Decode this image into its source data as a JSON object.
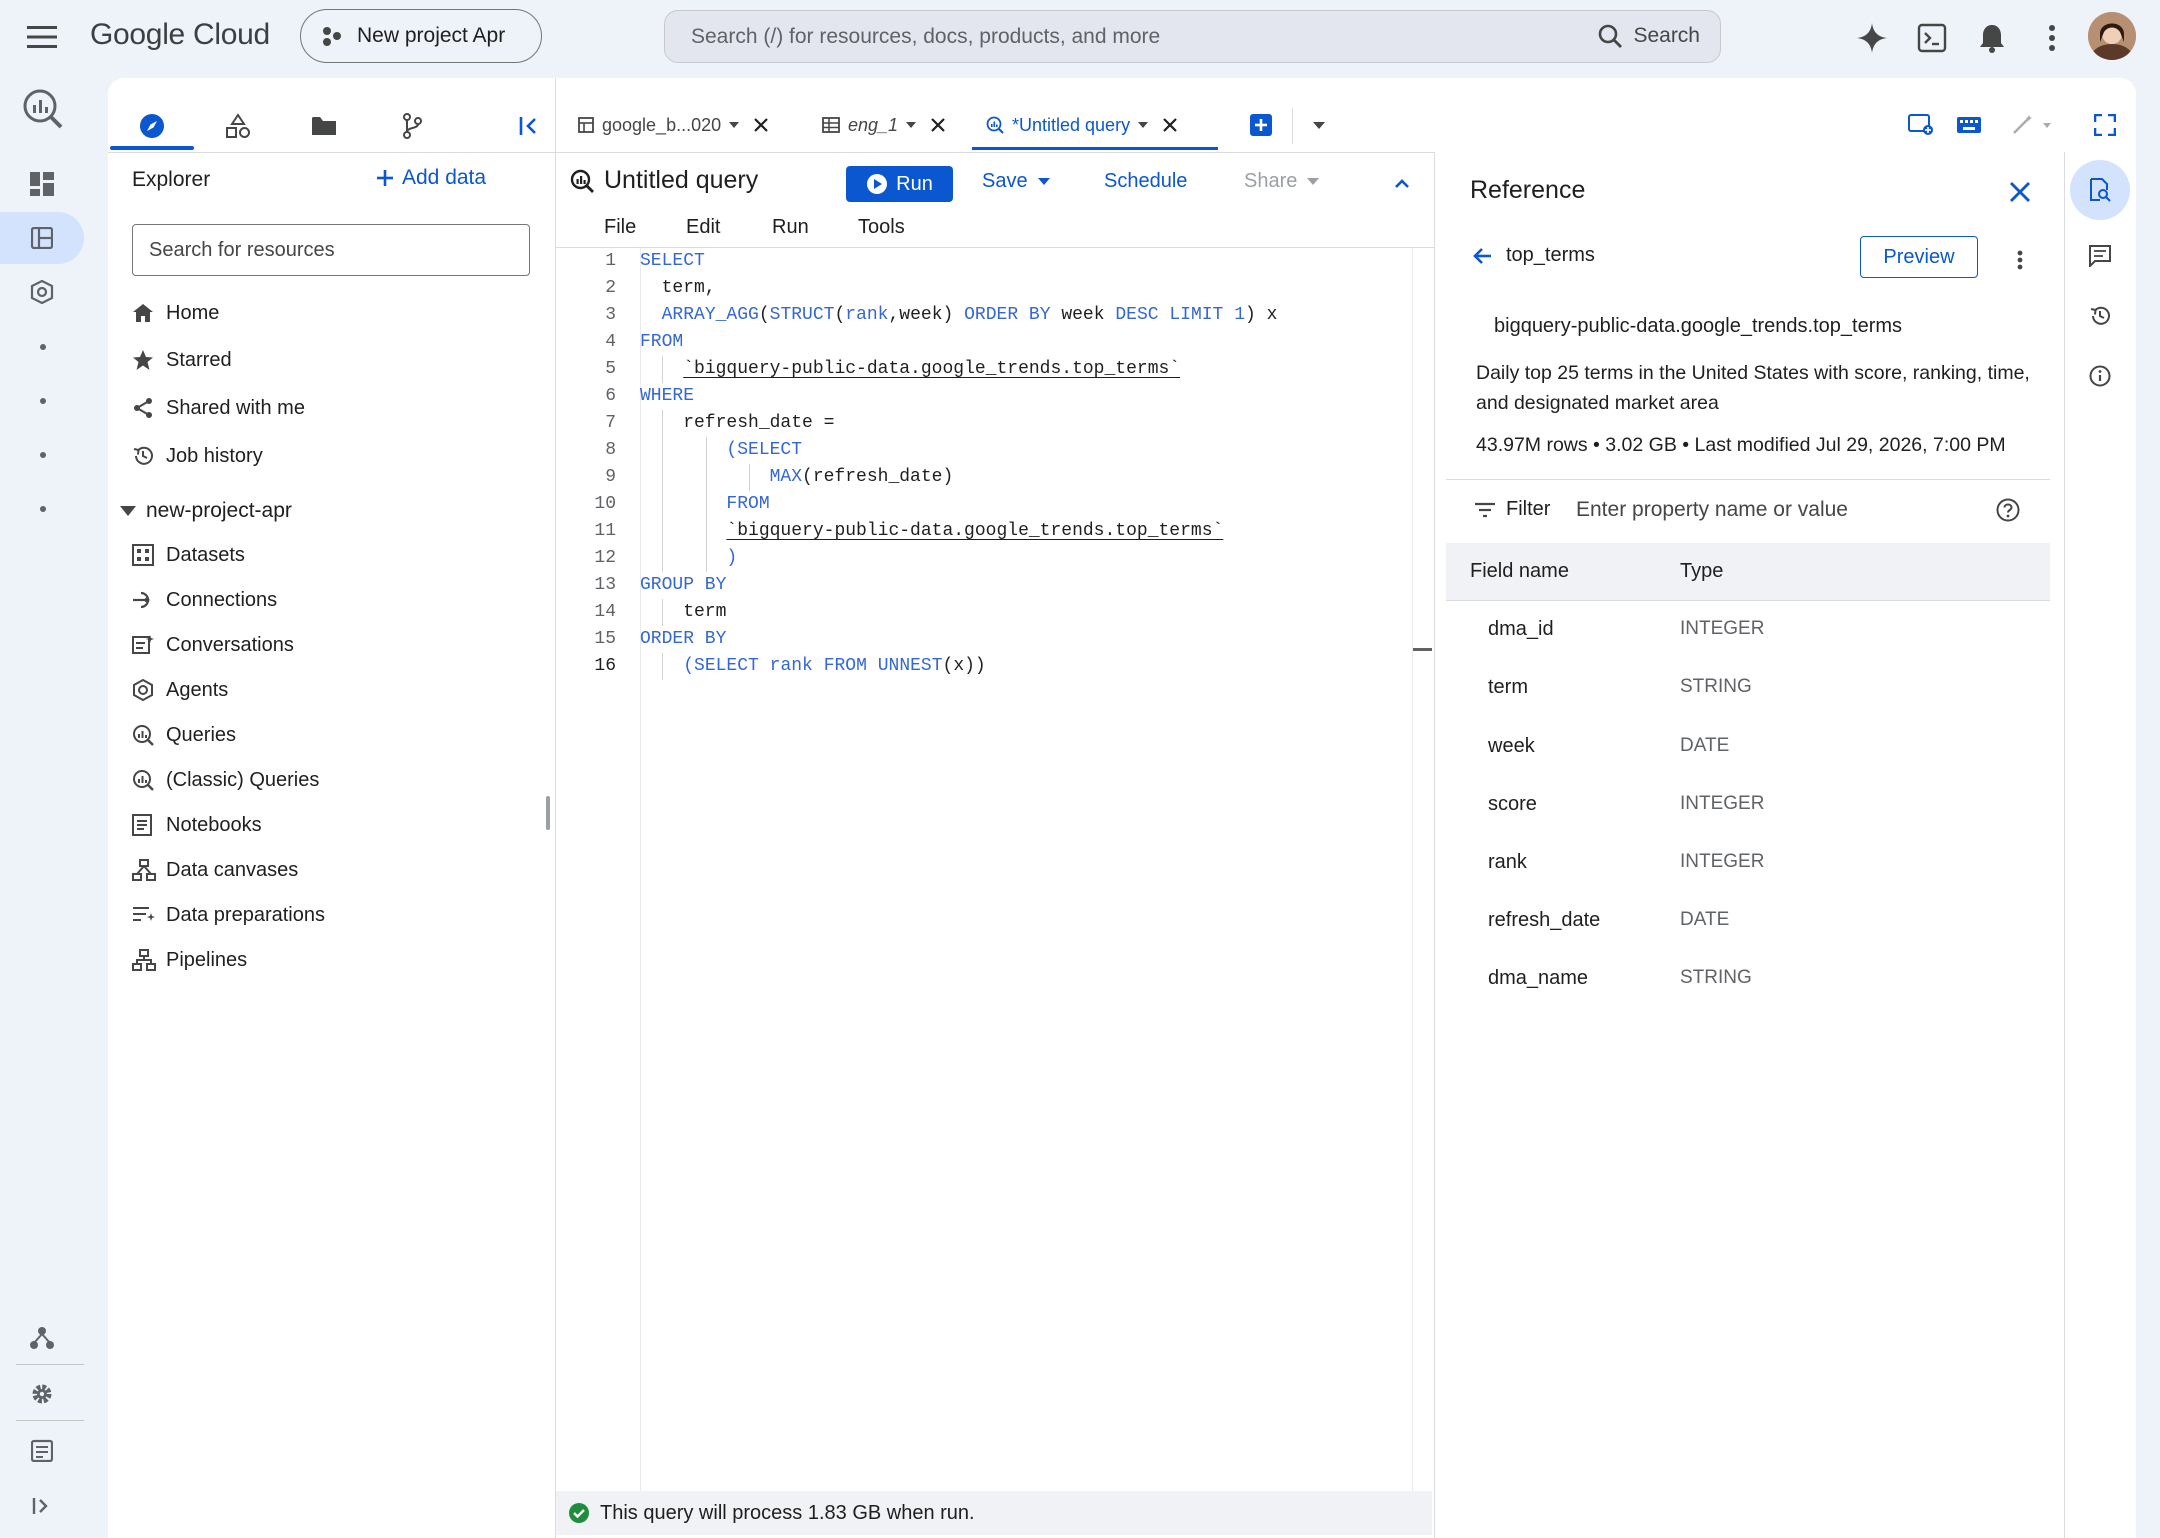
{
  "topbar": {
    "logo": "Google Cloud",
    "project": "New project Apr",
    "search_placeholder": "Search (/) for resources, docs, products, and more",
    "search_button": "Search"
  },
  "explorer": {
    "title": "Explorer",
    "add_data": "Add data",
    "search_placeholder": "Search for resources",
    "nav": [
      {
        "label": "Home",
        "icon": "home-icon"
      },
      {
        "label": "Starred",
        "icon": "star-icon"
      },
      {
        "label": "Shared with me",
        "icon": "share-icon"
      },
      {
        "label": "Job history",
        "icon": "history-icon"
      }
    ],
    "project_name": "new-project-apr",
    "project_items": [
      {
        "label": "Datasets",
        "icon": "dataset-icon"
      },
      {
        "label": "Connections",
        "icon": "connection-icon"
      },
      {
        "label": "Conversations",
        "icon": "conversation-icon"
      },
      {
        "label": "Agents",
        "icon": "agent-icon"
      },
      {
        "label": "Queries",
        "icon": "query-icon"
      },
      {
        "label": "(Classic) Queries",
        "icon": "query-icon"
      },
      {
        "label": "Notebooks",
        "icon": "notebook-icon"
      },
      {
        "label": "Data canvases",
        "icon": "canvas-icon"
      },
      {
        "label": "Data preparations",
        "icon": "preparation-icon"
      },
      {
        "label": "Pipelines",
        "icon": "pipeline-icon"
      }
    ]
  },
  "tabs": [
    {
      "label": "google_b...020",
      "icon": "table-icon"
    },
    {
      "label": "eng_1",
      "icon": "grid-icon"
    },
    {
      "label": "*Untitled query",
      "icon": "query-icon"
    }
  ],
  "editor": {
    "title": "Untitled query",
    "run": "Run",
    "save": "Save",
    "schedule": "Schedule",
    "share": "Share",
    "menus": [
      "File",
      "Edit",
      "Run",
      "Tools"
    ],
    "status": "This query will process 1.83 GB when run."
  },
  "reference": {
    "title": "Reference",
    "table_name": "top_terms",
    "preview": "Preview",
    "full_name": "bigquery-public-data.google_trends.top_terms",
    "description": "Daily top 25 terms in the United States with score, ranking, time, and designated market area",
    "meta": "43.97M rows • 3.02 GB • Last modified Jul 29, 2026, 7:00 PM",
    "filter_label": "Filter",
    "filter_placeholder": "Enter property name or value",
    "col_field": "Field name",
    "col_type": "Type",
    "fields": [
      {
        "name": "dma_id",
        "type": "INTEGER"
      },
      {
        "name": "term",
        "type": "STRING"
      },
      {
        "name": "week",
        "type": "DATE"
      },
      {
        "name": "score",
        "type": "INTEGER"
      },
      {
        "name": "rank",
        "type": "INTEGER"
      },
      {
        "name": "refresh_date",
        "type": "DATE"
      },
      {
        "name": "dma_name",
        "type": "STRING"
      }
    ]
  },
  "colors": {
    "accent": "#0b57d0",
    "success": "#1e8e3e"
  }
}
